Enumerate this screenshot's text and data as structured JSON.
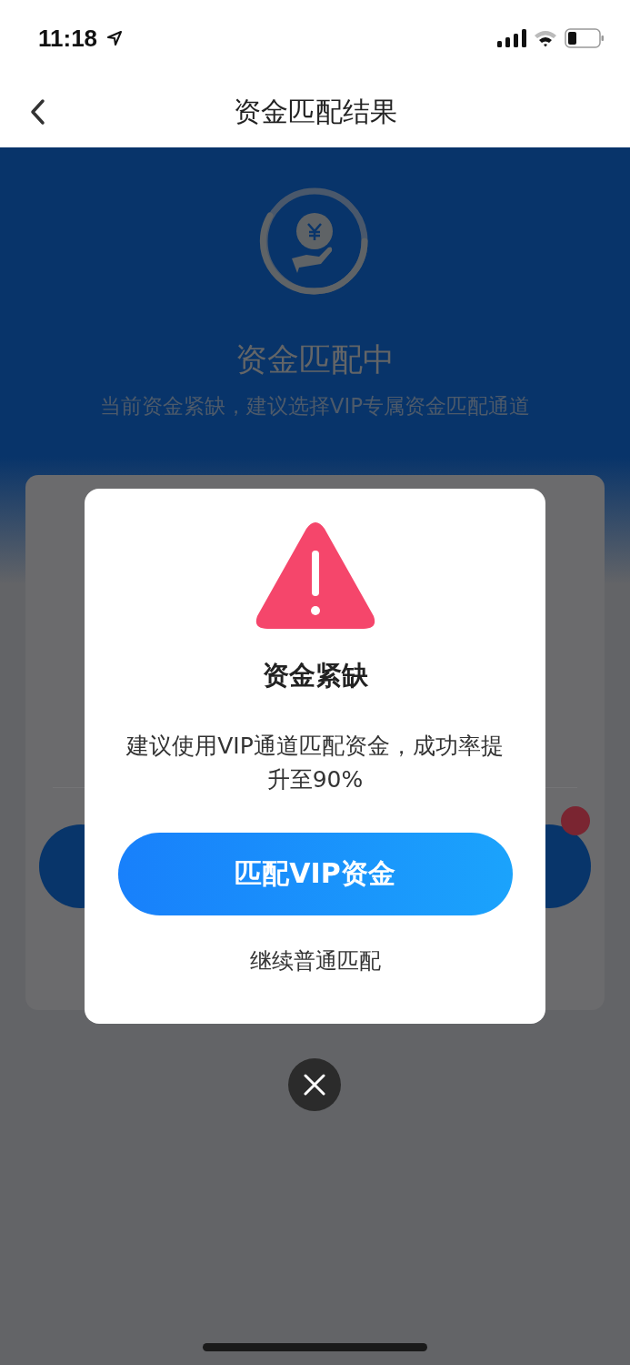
{
  "status_bar": {
    "time": "11:18"
  },
  "nav": {
    "title": "资金匹配结果"
  },
  "header": {
    "title": "资金匹配中",
    "subtitle": "当前资金紧缺，建议选择VIP专属资金匹配通道"
  },
  "dialog": {
    "title": "资金紧缺",
    "message": "建议使用VIP通道匹配资金，成功率提升至90%",
    "primary_button": "匹配VIP资金",
    "secondary_link": "继续普通匹配"
  }
}
